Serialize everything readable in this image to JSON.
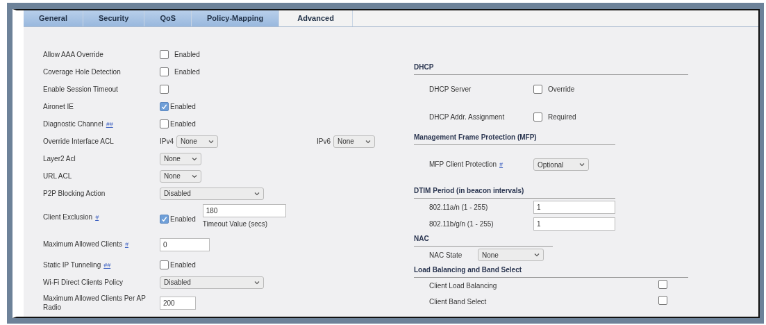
{
  "tabs": [
    {
      "label": "General",
      "selected": false
    },
    {
      "label": "Security",
      "selected": false
    },
    {
      "label": "QoS",
      "selected": false
    },
    {
      "label": "Policy-Mapping",
      "selected": false
    },
    {
      "label": "Advanced",
      "selected": true
    }
  ],
  "left_rows": [
    {
      "kind": "checkbox",
      "label": "Allow AAA Override",
      "checked": false,
      "option": "Enabled"
    },
    {
      "kind": "checkbox",
      "label": "Coverage Hole Detection",
      "checked": false,
      "option": "Enabled"
    },
    {
      "kind": "checkbox",
      "label": "Enable Session Timeout",
      "checked": false
    },
    {
      "kind": "checkbox",
      "label": "Aironet IE",
      "checked": true,
      "option": "Enabled"
    },
    {
      "kind": "checkbox",
      "label": "Diagnostic Channel",
      "note": "##",
      "checked": false,
      "option": "Enabled"
    },
    {
      "kind": "acl",
      "label": "Override Interface ACL",
      "ipv4_label": "IPv4",
      "ipv4_value": "None",
      "ipv6_label": "IPv6",
      "ipv6_value": "None"
    },
    {
      "kind": "select",
      "label": "Layer2 Acl",
      "value": "None"
    },
    {
      "kind": "select",
      "label": "URL ACL",
      "value": "None"
    },
    {
      "kind": "wide_select",
      "label": "P2P Blocking Action",
      "value": "Disabled"
    },
    {
      "kind": "exclusion",
      "label": "Client Exclusion",
      "note": "#",
      "checked": true,
      "option": "Enabled",
      "value": "180",
      "caption": "Timeout Value (secs)"
    },
    {
      "kind": "text",
      "label": "Maximum Allowed Clients",
      "note": "#",
      "value": "0"
    },
    {
      "kind": "checkbox",
      "label": "Static IP Tunneling",
      "note": "##",
      "checked": false,
      "option": "Enabled"
    },
    {
      "kind": "wide_select",
      "label": "Wi-Fi Direct Clients Policy",
      "value": "Disabled"
    },
    {
      "kind": "text",
      "label": "Maximum Allowed Clients Per AP Radio",
      "value": "200"
    }
  ],
  "right_sections": [
    {
      "heading": "DHCP",
      "rows": [
        {
          "kind": "checkbox",
          "label": "DHCP Server",
          "checked": false,
          "option": "Override"
        },
        {
          "kind": "checkbox",
          "label": "DHCP Addr. Assignment",
          "checked": false,
          "option": "Required"
        }
      ]
    },
    {
      "heading": "Management Frame Protection (MFP)",
      "rows": [
        {
          "kind": "select",
          "label": "MFP Client Protection",
          "note": "#",
          "value": "Optional"
        }
      ]
    },
    {
      "heading": "DTIM Period (in beacon intervals)",
      "rows": [
        {
          "kind": "text",
          "label": "802.11a/n (1 - 255)",
          "value": "1"
        },
        {
          "kind": "text",
          "label": "802.11b/g/n (1 - 255)",
          "value": "1"
        }
      ]
    },
    {
      "heading": "NAC",
      "rows": [
        {
          "kind": "select",
          "label": "NAC State",
          "value": "None"
        }
      ]
    },
    {
      "heading": "Load Balancing and Band Select",
      "rows": [
        {
          "kind": "far_checkbox",
          "label": "Client Load Balancing",
          "checked": false
        },
        {
          "kind": "far_checkbox",
          "label": "Client Band Select",
          "checked": false
        }
      ]
    }
  ]
}
